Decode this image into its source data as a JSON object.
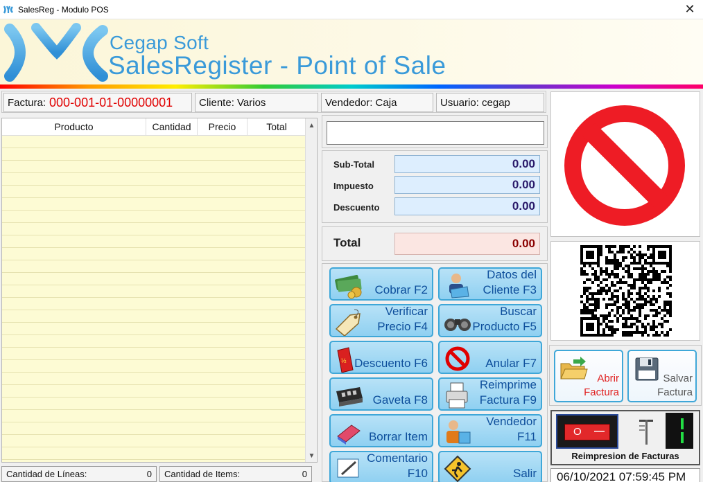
{
  "window": {
    "title": "SalesReg - Modulo POS",
    "close_glyph": "✕"
  },
  "banner": {
    "brand": "Cegap Soft",
    "product": "SalesRegister - Point of Sale"
  },
  "info": {
    "factura_label": "Factura:",
    "factura_value": "000-001-01-00000001",
    "cliente": "Cliente: Varios",
    "vendedor": "Vendedor: Caja",
    "usuario": "Usuario: cegap"
  },
  "grid": {
    "columns": [
      "Producto",
      "Cantidad",
      "Precio",
      "Total"
    ],
    "rows": []
  },
  "status": {
    "lineas_label": "Cantidad de Líneas:",
    "lineas_value": "0",
    "items_label": "Cantidad de Items:",
    "items_value": "0"
  },
  "scan": {
    "value": ""
  },
  "totals": {
    "subtotal_label": "Sub-Total",
    "subtotal_value": "0.00",
    "impuesto_label": "Impuesto",
    "impuesto_value": "0.00",
    "descuento_label": "Descuento",
    "descuento_value": "0.00",
    "total_label": "Total",
    "total_value": "0.00"
  },
  "actions": {
    "cobrar": "Cobrar F2",
    "datos_cliente": "Datos del\nCliente F3",
    "verificar": "Verificar\nPrecio F4",
    "buscar": "Buscar\nProducto F5",
    "descuento": "Descuento F6",
    "anular": "Anular F7",
    "gaveta": "Gaveta F8",
    "reimprime": "Reimprime\nFactura F9",
    "borrar": "Borrar Item",
    "vendedor": "Vendedor\nF11",
    "comentario": "Comentario\nF10",
    "salir": "Salir"
  },
  "side": {
    "abrir": "Abrir\nFactura",
    "salvar": "Salvar\nFactura",
    "reimpresion": "Reimpresion de Facturas",
    "datetime": "06/10/2021 07:59:45 PM",
    "switch_on": "O",
    "switch_off": "—"
  },
  "colors": {
    "accent": "#3a9ad9",
    "button_border": "#3fa7d8",
    "invoice_red": "#e00000",
    "grid_bg": "#fdfbd4"
  }
}
